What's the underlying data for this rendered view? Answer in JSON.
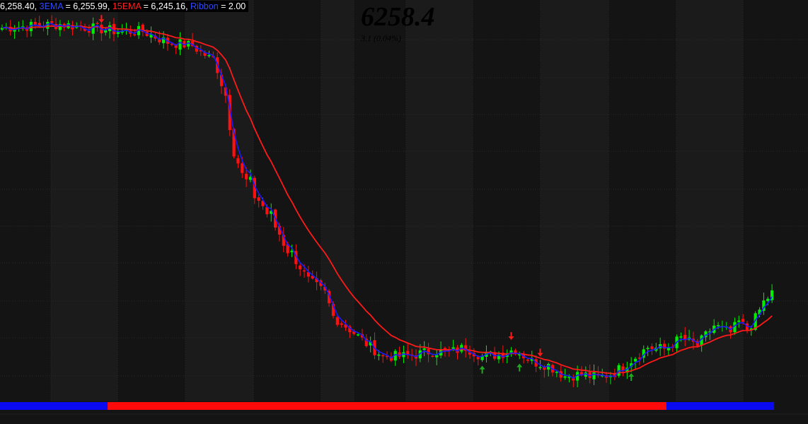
{
  "legend": {
    "close_text": "6,258.40,",
    "ema3_label": "3EMA",
    "ema3_value": " = 6,255.99,",
    "ema15_label": "15EMA",
    "ema15_value": " = 6,245.16,",
    "ribbon_label": "Ribbon",
    "ribbon_value": " = 2.00"
  },
  "quote": {
    "last": "6258.4",
    "change": "3.1 (0.04%)"
  },
  "colors": {
    "up": "#00ee00",
    "down": "#ff1010",
    "ema_fast": "#1a1aff",
    "ema_slow": "#ff1a1a",
    "ribbon_blue": "#0a0af0",
    "ribbon_red": "#ff0a0a",
    "ema3_label": "#2f4bff",
    "ema15_label": "#ff2020",
    "ribbon_label": "#2f4bff"
  },
  "chart_data": {
    "type": "candlestick",
    "ylim": [
      6048,
      6268
    ],
    "grid": true,
    "series": [
      {
        "name": "3EMA",
        "kind": "line"
      },
      {
        "name": "15EMA",
        "kind": "line"
      }
    ],
    "anchors": [
      {
        "i": 0,
        "v": 6255
      },
      {
        "i": 14,
        "v": 6257
      },
      {
        "i": 28,
        "v": 6253
      },
      {
        "i": 34,
        "v": 6253
      },
      {
        "i": 40,
        "v": 6247
      },
      {
        "i": 46,
        "v": 6245
      },
      {
        "i": 52,
        "v": 6235
      },
      {
        "i": 54,
        "v": 6218
      },
      {
        "i": 56,
        "v": 6190
      },
      {
        "i": 58,
        "v": 6172
      },
      {
        "i": 62,
        "v": 6160
      },
      {
        "i": 66,
        "v": 6145
      },
      {
        "i": 70,
        "v": 6130
      },
      {
        "i": 74,
        "v": 6115
      },
      {
        "i": 78,
        "v": 6108
      },
      {
        "i": 80,
        "v": 6095
      },
      {
        "i": 84,
        "v": 6088
      },
      {
        "i": 88,
        "v": 6080
      },
      {
        "i": 92,
        "v": 6073
      },
      {
        "i": 98,
        "v": 6073
      },
      {
        "i": 104,
        "v": 6076
      },
      {
        "i": 108,
        "v": 6075
      },
      {
        "i": 112,
        "v": 6078
      },
      {
        "i": 116,
        "v": 6073
      },
      {
        "i": 120,
        "v": 6074
      },
      {
        "i": 124,
        "v": 6077
      },
      {
        "i": 128,
        "v": 6070
      },
      {
        "i": 132,
        "v": 6068
      },
      {
        "i": 136,
        "v": 6062
      },
      {
        "i": 140,
        "v": 6063
      },
      {
        "i": 144,
        "v": 6061
      },
      {
        "i": 148,
        "v": 6064
      },
      {
        "i": 152,
        "v": 6071
      },
      {
        "i": 156,
        "v": 6078
      },
      {
        "i": 160,
        "v": 6077
      },
      {
        "i": 164,
        "v": 6083
      },
      {
        "i": 168,
        "v": 6079
      },
      {
        "i": 172,
        "v": 6090
      },
      {
        "i": 176,
        "v": 6086
      },
      {
        "i": 178,
        "v": 6092
      },
      {
        "i": 180,
        "v": 6088
      },
      {
        "i": 182,
        "v": 6094
      },
      {
        "i": 184,
        "v": 6103
      },
      {
        "i": 186,
        "v": 6108
      }
    ],
    "bars": 187,
    "signals": [
      {
        "type": "sell",
        "i": 24
      },
      {
        "type": "sell",
        "i": 123
      },
      {
        "type": "sell",
        "i": 130
      },
      {
        "type": "buy",
        "i": 116
      },
      {
        "type": "buy",
        "i": 125
      },
      {
        "type": "buy",
        "i": 152
      }
    ],
    "ribbon": [
      {
        "state": "blue",
        "from": 0,
        "to": 26
      },
      {
        "state": "red",
        "from": 26,
        "to": 161
      },
      {
        "state": "blue",
        "from": 161,
        "to": 186
      }
    ]
  }
}
